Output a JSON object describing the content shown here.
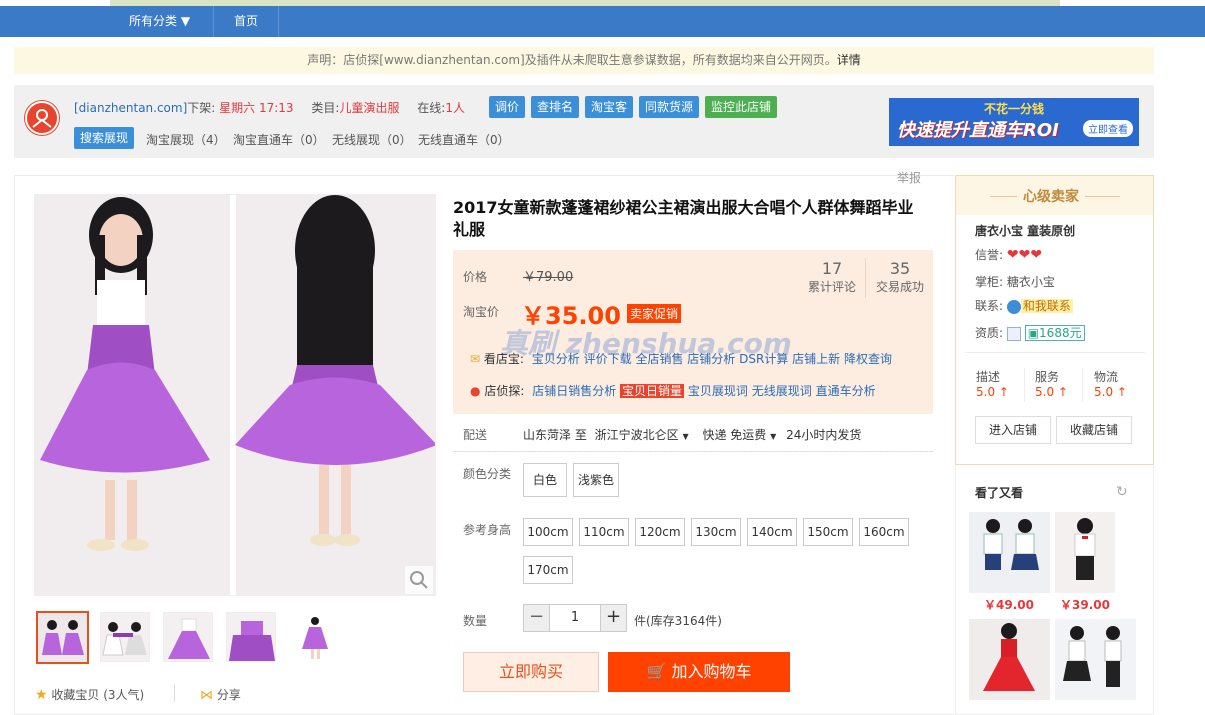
{
  "nav": {
    "all_categories": "所有分类",
    "home": "首页"
  },
  "notice": {
    "text": "声明：店侦探[www.dianzhentan.com]及插件从未爬取生意参谋数据，所有数据均来自公开网页。",
    "link": "详情"
  },
  "info": {
    "site": "[dianzhentan.com]",
    "down_label": "下架:",
    "down_value": "星期六 17:13",
    "cat_label": "类目:",
    "cat_value": "儿童演出服",
    "online_label": "在线:",
    "online_value": "1人",
    "buttons": [
      "调价",
      "查排名",
      "淘宝客",
      "同款货源",
      "监控此店铺"
    ],
    "search_show": "搜索展现",
    "tabs": [
      "淘宝展现（4）",
      "淘宝直通车（0）",
      "无线展现（0）",
      "无线直通车（0）"
    ]
  },
  "ad": {
    "line1": "不花一分钱",
    "line2": "快速提升直通车ROI",
    "cta": "立即查看"
  },
  "report": "举报",
  "product": {
    "title": "2017女童新款蓬蓬裙纱裙公主裙演出服大合唱个人群体舞蹈毕业礼服",
    "price_label": "价格",
    "price_original": "￥79.00",
    "taobao_price_label": "淘宝价",
    "price_now": "￥35.00",
    "promo": "卖家促销",
    "reviews_count": "17",
    "reviews_label": "累计评论",
    "sold_count": "35",
    "sold_label": "交易成功",
    "watermark": "真刷 zhenshua.com",
    "kds_label": "看店宝:",
    "kds_links": [
      "宝贝分析",
      "评价下载",
      "全店销售",
      "店铺分析",
      "DSR计算",
      "店铺上新",
      "降权查询"
    ],
    "dzt_label": "店侦探:",
    "dzt_links": [
      "店铺日销售分析",
      "宝贝日销量",
      "宝贝展现词",
      "无线展现词",
      "直通车分析"
    ],
    "ship_label": "配送",
    "ship_from": "山东菏泽 至",
    "ship_to": "浙江宁波北仑区",
    "ship_fee": "快递 免运费",
    "ship_time": "24小时内发货",
    "color_label": "颜色分类",
    "colors": [
      "白色",
      "浅紫色"
    ],
    "height_label": "参考身高",
    "heights": [
      "100cm",
      "110cm",
      "120cm",
      "130cm",
      "140cm",
      "150cm",
      "160cm",
      "170cm"
    ],
    "qty_label": "数量",
    "qty_value": "1",
    "qty_minus": "−",
    "qty_plus": "+",
    "stock": "件(库存3164件)",
    "buy_now": "立即购买",
    "add_cart": "加入购物车",
    "fav": "收藏宝贝 (3人气)",
    "share": "分享"
  },
  "seller": {
    "badge": "心级卖家",
    "shop_name": "唐衣小宝 童装原创",
    "credit_label": "信誉:",
    "keeper_label": "掌柜:",
    "keeper": "糖衣小宝",
    "contact_label": "联系:",
    "contact": "和我联系",
    "qual_label": "资质:",
    "qual_1688": "1688元",
    "ratings": [
      {
        "label": "描述",
        "value": "5.0"
      },
      {
        "label": "服务",
        "value": "5.0"
      },
      {
        "label": "物流",
        "value": "5.0"
      }
    ],
    "enter_shop": "进入店铺",
    "fav_shop": "收藏店铺"
  },
  "also": {
    "title": "看了又看",
    "prices": [
      "￥49.00",
      "￥39.00"
    ]
  },
  "colors": {
    "nav": "#3b7ac7",
    "accent": "#ff4200",
    "price": "#ff4200",
    "dress": "#b15fd6"
  }
}
